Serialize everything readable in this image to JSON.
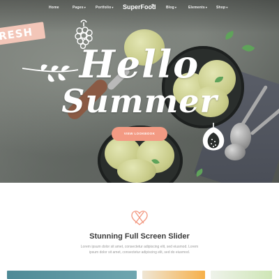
{
  "nav": {
    "items": [
      "Home",
      "Pages",
      "Portfolio",
      "Blog",
      "Elements",
      "Shop"
    ],
    "logo": "SuperFood"
  },
  "hero": {
    "badge": "RESH",
    "headline_line1": "Hello",
    "headline_line2": "Summer",
    "cta_label": "VIEW LOOKBOOK"
  },
  "section": {
    "title": "Stunning Full Screen Slider",
    "text_line1": "Lorem ipsum dolor sit amet, consectetur adipiscing elit, sed eiusmod. Lorem",
    "text_line2": "ipsum dolor sit amet, consectetur adipiscing elit, sed do eiusmod."
  },
  "colors": {
    "accent": "#f39a83",
    "badge": "#f3c6b8",
    "heading": "#3a3a3a",
    "body_text": "#9a9a9a"
  }
}
